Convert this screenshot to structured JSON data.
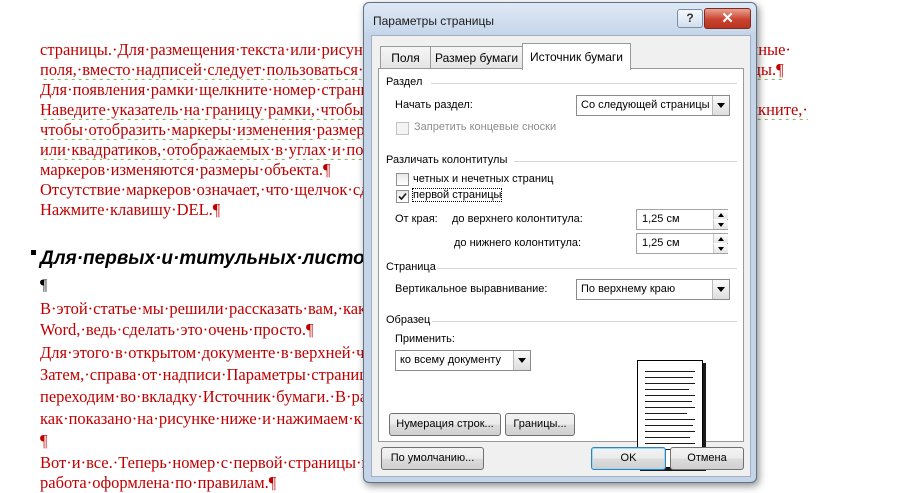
{
  "document": {
    "lines": [
      "страницы.·Для·размещения·текста·или·рисунка·на·странице·используйте·надписи.·Чтобы·определенные·",
      "поля,·вместо·надписей·следует·пользоваться·рамками.·Рамки·позволяют·отображать·номера·страницы.¶",
      "Для·появления·рамки·щелкните·номер·страницы·в·колонтитуле·два·раза·левой·кнопкой.¶",
      "Наведите·указатель·на·границу·рамки,·чтобы·он·принял·форму·четырехглавой·стрелки,·а·затем·щелкните,·",
      "чтобы·отобразить·маркеры·изменения·размера·рамки.·Маркеры·имеют·вид·нескольких·кружков·",
      "или·квадратиков,·отображаемых·в·углах·и·по·сторонам·рамки.·При·перетаскивании·этих·",
      "маркеров·изменяются·размеры·объекта.¶",
      "Отсутствие·маркеров·означает,·что·щелчок·сделан·не·на·границе·рамки.¶",
      "Нажмите·клавишу·DEL.¶"
    ],
    "heading": "Для·первых·и·титульных·листов",
    "para_mark": "¶",
    "lines2": [
      "В·этой·статье·мы·решили·рассказать·вам,·как·убрать·номер·с·первой·страницы·в·документе·",
      "Word,·ведь·сделать·это·очень·просто.¶",
      "Для·этого·в·открытом·документе·в·верхней·части·окна·откройте·вкладку·Разметка·страницы.¶",
      "Затем,·справа·от·надписи·Параметры·страницы·нажмите·на·значок.·В·открывшемся·окне·",
      "переходим·во·вкладку·Источник·бумаги.·В·разделе·Различать·колонтитулы·ставим·галочку·",
      "как·показано·на·рисунке·ниже·и·нажимаем·кнопку·ОК.¶",
      "¶",
      "Вот·и·все.·Теперь·номер·с·первой·страницы·исчез,·и·ваша·курсовая·или·дипломная·",
      "работа·оформлена·по·правилам.¶"
    ]
  },
  "dialog": {
    "title": "Параметры страницы",
    "help_label": "?",
    "close_label": "✕",
    "tabs": [
      "Поля",
      "Размер бумаги",
      "Источник бумаги"
    ],
    "active_tab": "Источник бумаги",
    "section": {
      "group_label": "Раздел",
      "start_label": "Начать раздел:",
      "start_value": "Со следующей страницы",
      "suppress_endnotes_label": "Запретить концевые сноски",
      "suppress_endnotes_checked": false
    },
    "headers": {
      "group_label": "Различать колонтитулы",
      "odd_even_label": "четных и нечетных страниц",
      "odd_even_checked": false,
      "first_page_label": "первой страницы",
      "first_page_checked": true,
      "from_edge_label": "От края:",
      "header_label": "до верхнего колонтитула:",
      "header_value": "1,25 см",
      "footer_label": "до нижнего колонтитула:",
      "footer_value": "1,25 см"
    },
    "page": {
      "group_label": "Страница",
      "valign_label": "Вертикальное выравнивание:",
      "valign_value": "По верхнему краю"
    },
    "preview": {
      "group_label": "Образец",
      "apply_label": "Применить:",
      "apply_value": "ко всему документу"
    },
    "buttons": {
      "line_numbers": "Нумерация строк...",
      "borders": "Границы...",
      "default": "По умолчанию...",
      "ok": "OK",
      "cancel": "Отмена"
    }
  },
  "colors": {
    "doc_text": "#c00000",
    "dialog_frame": "#c5d4e6",
    "close_button": "#c9442f",
    "default_button_border": "#3c7fb1"
  }
}
